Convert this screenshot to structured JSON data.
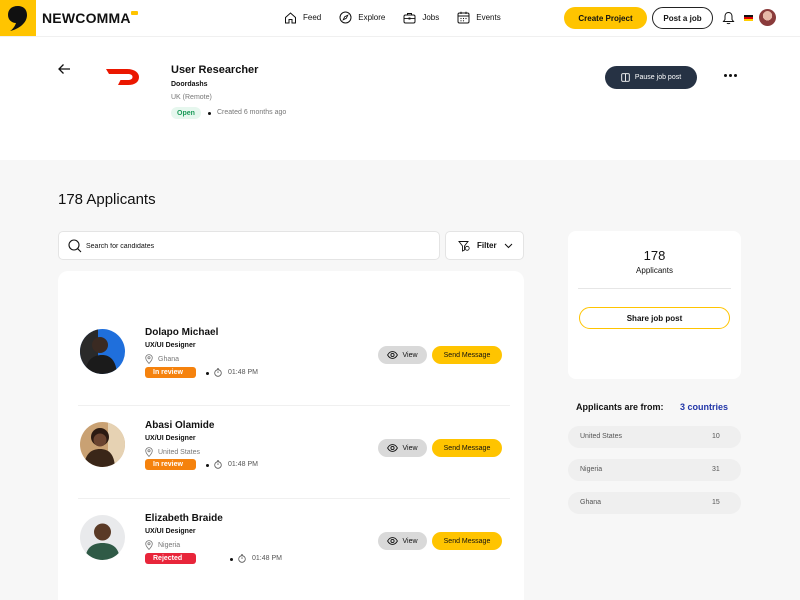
{
  "brand": {
    "name": "NEWCOMMA"
  },
  "nav": {
    "items": [
      {
        "label": "Feed",
        "icon": "home-icon"
      },
      {
        "label": "Explore",
        "icon": "compass-icon"
      },
      {
        "label": "Jobs",
        "icon": "briefcase-icon"
      },
      {
        "label": "Events",
        "icon": "calendar-icon"
      }
    ],
    "create_project": "Create Project",
    "post_job": "Post a job"
  },
  "job": {
    "title": "User Researcher",
    "company": "Doordashs",
    "location": "UK (Remote)",
    "status": "Open",
    "created": "Created 6 months ago",
    "pause_label": "Pause job post"
  },
  "applicants": {
    "heading": "178 Applicants",
    "search_placeholder": "Search for candidates",
    "filter_label": "Filter",
    "view_label": "View",
    "message_label": "Send Message",
    "list": [
      {
        "name": "Dolapo Michael",
        "role": "UX/UI Designer",
        "country": "Ghana",
        "status": "In review",
        "time": "01:48 PM",
        "status_color": "#f5820d"
      },
      {
        "name": "Abasi Olamide",
        "role": "UX/UI Designer",
        "country": "United States",
        "status": "In review",
        "time": "01:48 PM",
        "status_color": "#f5820d"
      },
      {
        "name": "Elizabeth Braide",
        "role": "UX/UI Designer",
        "country": "Nigeria",
        "status": "Rejected",
        "time": "01:48 PM",
        "status_color": "#e8253a"
      }
    ]
  },
  "stats": {
    "count": "178",
    "label": "Applicants",
    "share_label": "Share job post",
    "from_heading": "Applicants are from:",
    "from_countries": "3 countries",
    "countries": [
      {
        "name": "United States",
        "count": "10"
      },
      {
        "name": "Nigeria",
        "count": "31"
      },
      {
        "name": "Ghana",
        "count": "15"
      }
    ]
  },
  "colors": {
    "accent": "#ffc400",
    "dark_button": "#263244",
    "link_blue": "#2236a8"
  }
}
